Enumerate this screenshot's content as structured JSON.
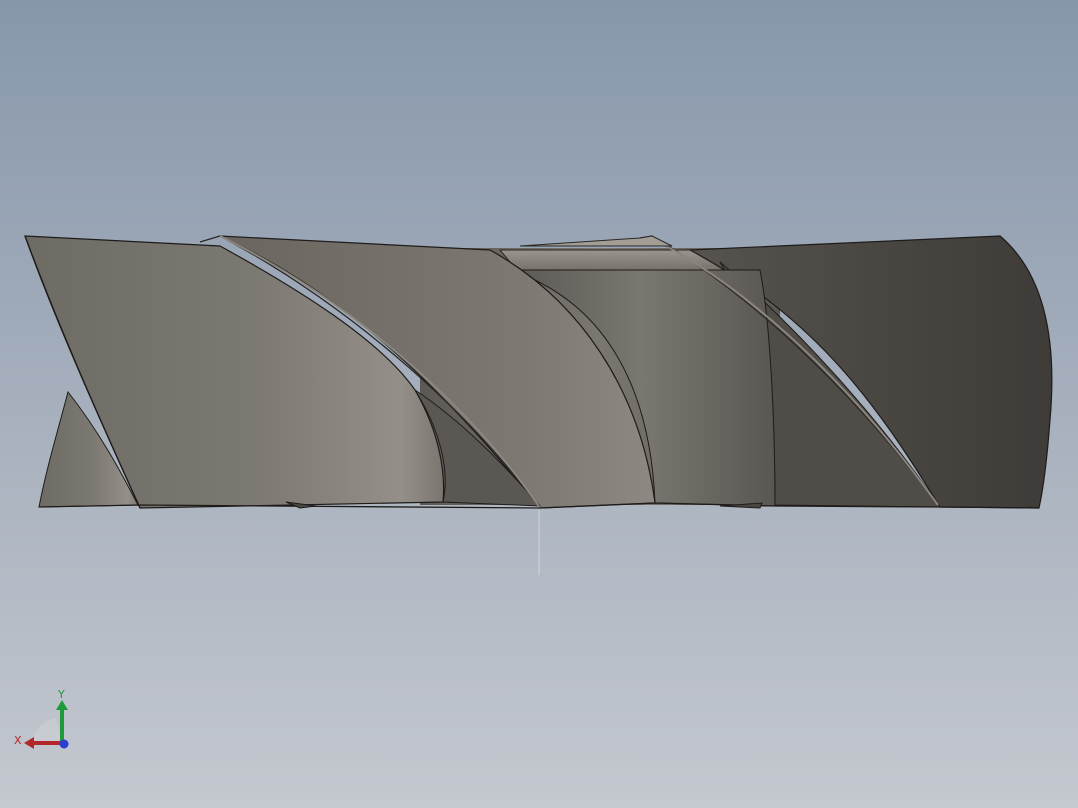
{
  "viewport": {
    "background_top": "#8797ab",
    "background_bottom": "#c4c8cf"
  },
  "model": {
    "description_icon": "helical-flute-part",
    "body_color": "#78746e",
    "dark_face_color": "#46423e",
    "edge_color": "#1e1c1a"
  },
  "view_triad": {
    "x_label": "X",
    "y_label": "Y",
    "x_color": "#b3262a",
    "y_color": "#1f9a3a",
    "z_color": "#2a3fd0"
  }
}
